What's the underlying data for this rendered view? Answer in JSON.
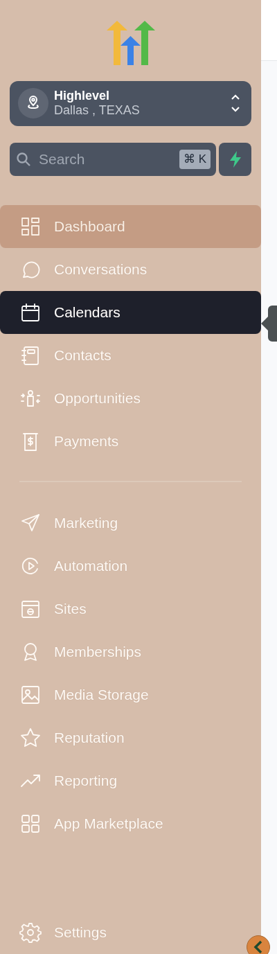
{
  "location": {
    "name": "Highlevel",
    "place": "Dallas , TEXAS"
  },
  "search": {
    "placeholder": "Search",
    "shortcut": "⌘ K"
  },
  "nav_main": [
    {
      "label": "Dashboard",
      "hovered": true,
      "selected": false
    },
    {
      "label": "Conversations",
      "hovered": false,
      "selected": false
    },
    {
      "label": "Calendars",
      "hovered": false,
      "selected": true
    },
    {
      "label": "Contacts",
      "hovered": false,
      "selected": false
    },
    {
      "label": "Opportunities",
      "hovered": false,
      "selected": false
    },
    {
      "label": "Payments",
      "hovered": false,
      "selected": false
    }
  ],
  "nav_tools": [
    {
      "label": "Marketing",
      "hovered": false,
      "selected": false
    },
    {
      "label": "Automation",
      "hovered": false,
      "selected": false
    },
    {
      "label": "Sites",
      "hovered": false,
      "selected": false
    },
    {
      "label": "Memberships",
      "hovered": false,
      "selected": false
    },
    {
      "label": "Media Storage",
      "hovered": false,
      "selected": false
    },
    {
      "label": "Reputation",
      "hovered": false,
      "selected": false
    },
    {
      "label": "Reporting",
      "hovered": false,
      "selected": false
    },
    {
      "label": "App Marketplace",
      "hovered": false,
      "selected": false
    }
  ],
  "footer": {
    "label": "Settings",
    "hovered": false,
    "selected": false
  }
}
